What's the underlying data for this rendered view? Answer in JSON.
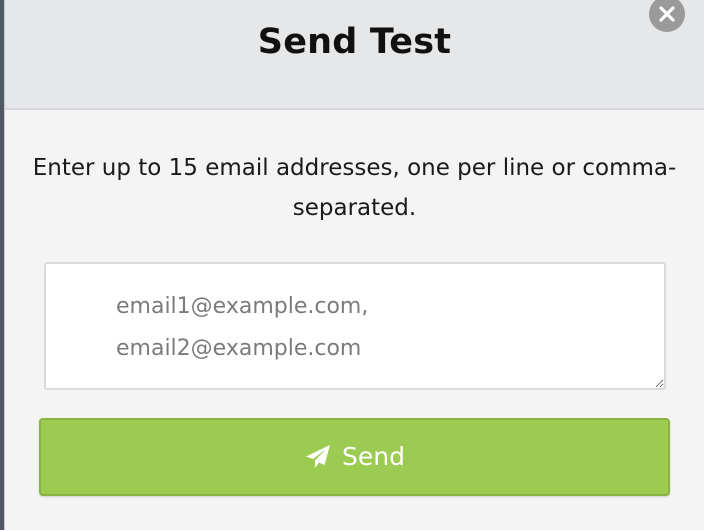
{
  "modal": {
    "title": "Send Test",
    "close_icon": "close-icon",
    "instructions": "Enter up to 15 email addresses, one per line or comma-separated.",
    "email_input": {
      "value": "",
      "placeholder": "email1@example.com,\nemail2@example.com"
    },
    "send_button": {
      "label": "Send",
      "icon": "paper-plane-icon"
    }
  },
  "colors": {
    "header_background": "#e6e7e9",
    "body_background": "#f4f4f5",
    "send_button": "#9ccb52",
    "close_button": "#9a9a9a"
  }
}
